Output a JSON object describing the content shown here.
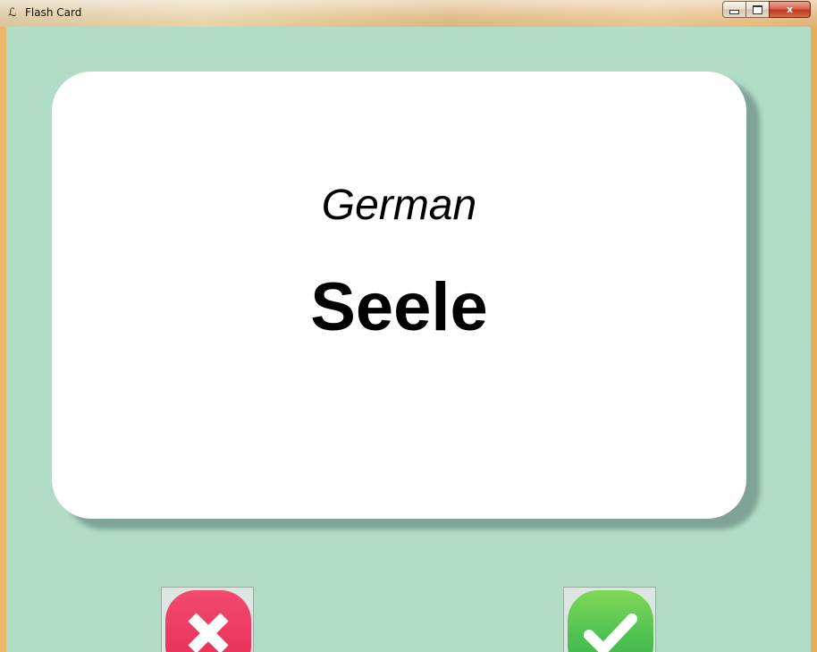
{
  "window": {
    "title": "Flash Card",
    "controls": {
      "minimize": "",
      "maximize": "",
      "close": "x"
    }
  },
  "card": {
    "language": "German",
    "word": "Seele"
  },
  "buttons": {
    "wrong": {
      "icon": "close-x-icon",
      "color": "#e62b55"
    },
    "right": {
      "icon": "checkmark-icon",
      "color": "#4fc151"
    }
  },
  "colors": {
    "background": "#b1ddc6",
    "card": "#ffffff"
  }
}
